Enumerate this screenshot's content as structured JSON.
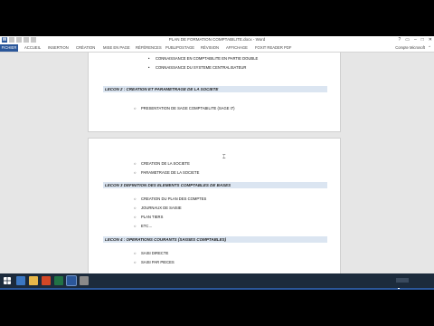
{
  "window": {
    "title": "PLAN DE FORMATION COMPTABILITE.docx - Word",
    "account": "Compte Microsoft",
    "app_logo": "W"
  },
  "ribbon": {
    "tabs": [
      "FICHIER",
      "ACCUEIL",
      "INSERTION",
      "CRÉATION",
      "MISE EN PAGE",
      "RÉFÉRENCES",
      "PUBLIPOSTAGE",
      "RÉVISION",
      "AFFICHAGE",
      "FOXIT READER PDF"
    ]
  },
  "document": {
    "page1": {
      "bullets_top": [
        "CONNAISSANCE EN COMPTABILITE EN PARTIE DOUBLE",
        "CONNAISSANCE DU SYSTEME CENTRALISATEUR"
      ],
      "heading2": "LECON 2 : CREATION ET PARAMETRAGE DE LA SOCIETE",
      "items2": [
        "PRESENTATION DE SAGE COMPTABILITE (SAGE I7)"
      ]
    },
    "page2": {
      "items_top": [
        "CREATION DE LA SOCIETE",
        "PARAMETRAGE DE LA SOCIETE"
      ],
      "heading3": "LECON 3 DEFINITION DES ELEMENTS COMPTABLES DE BASES",
      "items3": [
        "CREATION DU PLAN DES COMPTES",
        "JOURNAUX DE SAISIE",
        "PLAN TIERS",
        "ETC…"
      ],
      "heading4": "LECON 4 : OPERATIONS COURANTS (SAISIES COMPTABLES)",
      "items4": [
        "SAISI DIRECTE",
        "SAISI PAR PIECES"
      ]
    }
  },
  "statusbar": {
    "page": "PAGE 1 SUR 2",
    "words": "131 MOTS",
    "language": "FRANÇAIS (FRANCE)",
    "zoom": "100 %"
  },
  "colors": {
    "word_blue": "#2b579a",
    "heading_shade": "#dbe5f1",
    "taskbar": "#1c2b3c"
  }
}
